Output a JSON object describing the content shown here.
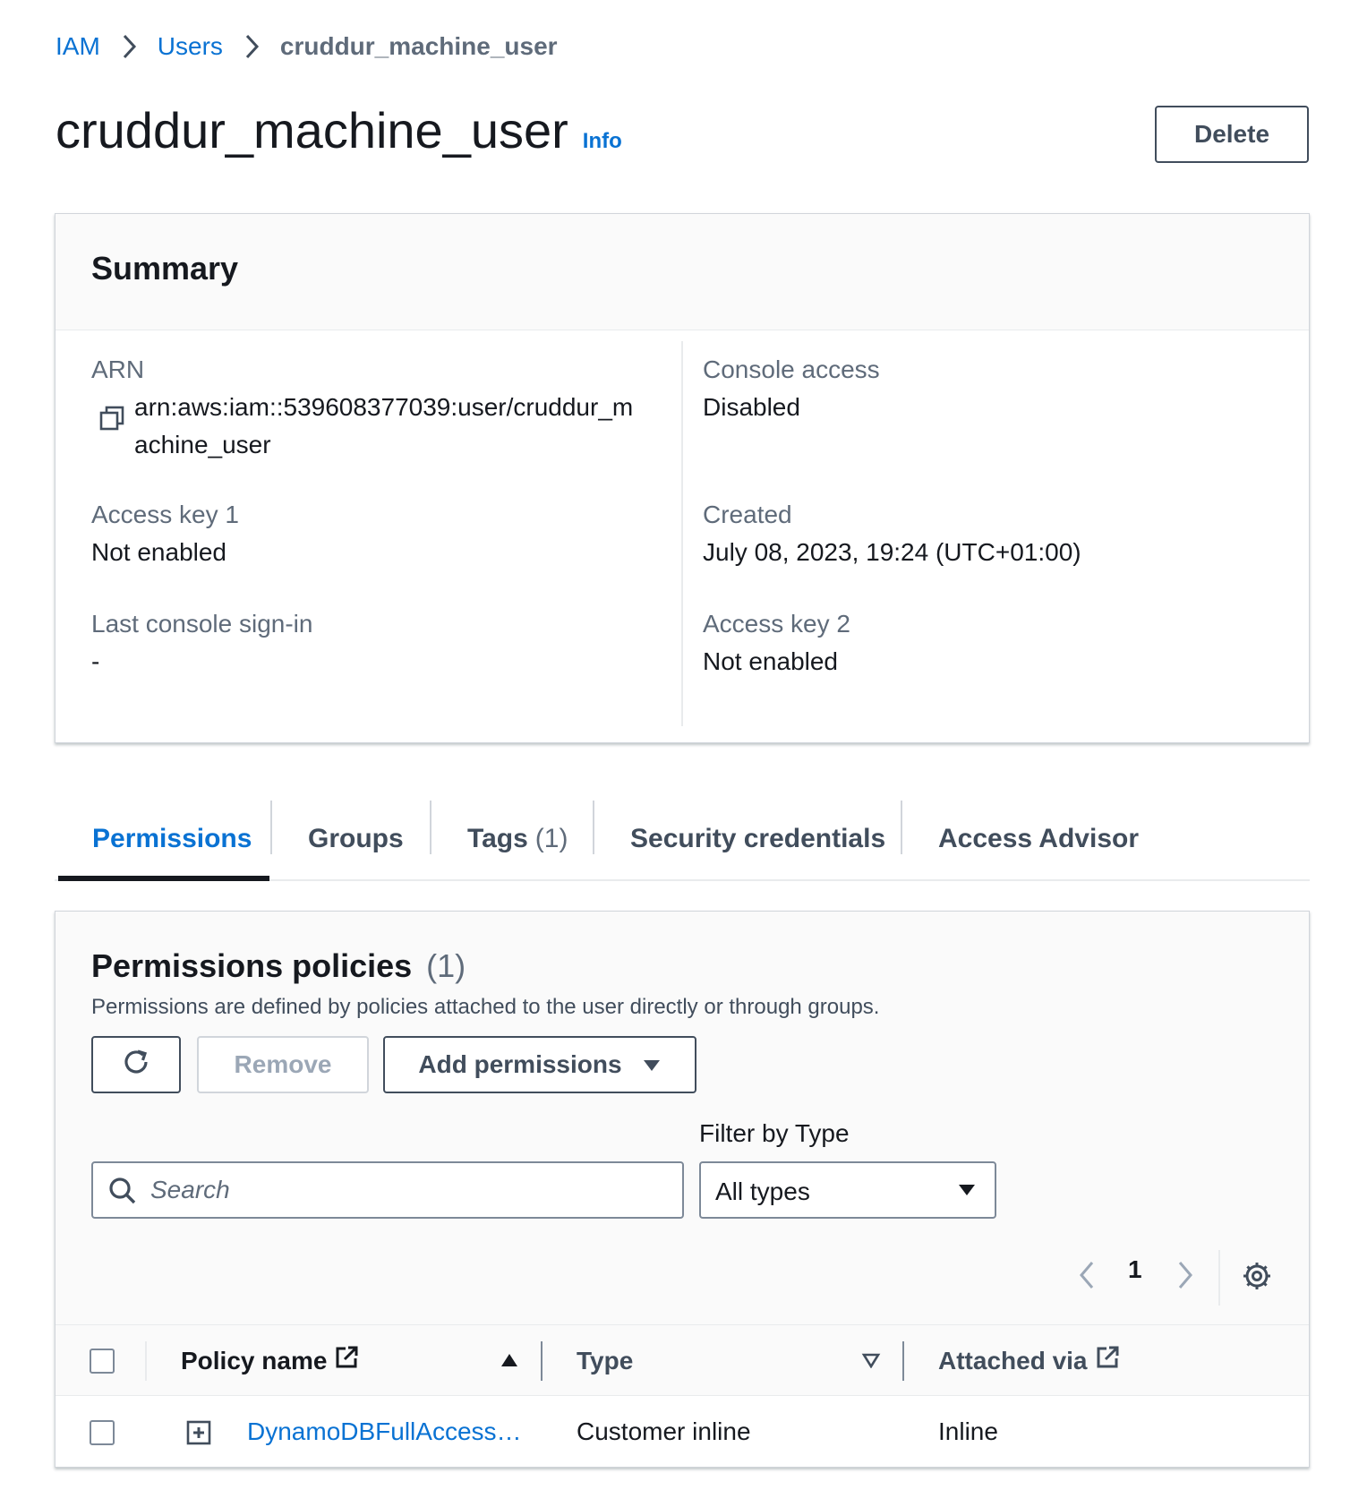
{
  "breadcrumb": {
    "items": [
      {
        "label": "IAM"
      },
      {
        "label": "Users"
      },
      {
        "label": "cruddur_machine_user"
      }
    ]
  },
  "header": {
    "title": "cruddur_machine_user",
    "info_label": "Info",
    "delete_label": "Delete"
  },
  "summary": {
    "title": "Summary",
    "arn_label": "ARN",
    "arn_value_line1": "arn:aws:iam::539608377039:user/cruddur_m",
    "arn_value_line2": "achine_user",
    "access_key_1_label": "Access key 1",
    "access_key_1_value": "Not enabled",
    "last_signin_label": "Last console sign-in",
    "last_signin_value": "-",
    "console_access_label": "Console access",
    "console_access_value": "Disabled",
    "created_label": "Created",
    "created_value": "July 08, 2023, 19:24 (UTC+01:00)",
    "access_key_2_label": "Access key 2",
    "access_key_2_value": "Not enabled"
  },
  "tabs": [
    {
      "label": "Permissions",
      "active": true
    },
    {
      "label": "Groups"
    },
    {
      "label": "Tags",
      "count": "(1)"
    },
    {
      "label": "Security credentials"
    },
    {
      "label": "Access Advisor"
    }
  ],
  "permissions": {
    "title": "Permissions policies",
    "count": "(1)",
    "description": "Permissions are defined by policies attached to the user directly or through groups.",
    "remove_label": "Remove",
    "add_label": "Add permissions",
    "filter_label": "Filter by Type",
    "search_placeholder": "Search",
    "filter_value": "All types",
    "page": "1",
    "columns": {
      "policy_name": "Policy name",
      "type": "Type",
      "attached_via": "Attached via"
    },
    "rows": [
      {
        "policy_name": "DynamoDBFullAccess…",
        "type": "Customer inline",
        "attached_via": "Inline"
      }
    ]
  },
  "colors": {
    "link": "#0972d3",
    "text": "#16191f",
    "muted": "#5f6b7a",
    "border": "#7d8998"
  }
}
